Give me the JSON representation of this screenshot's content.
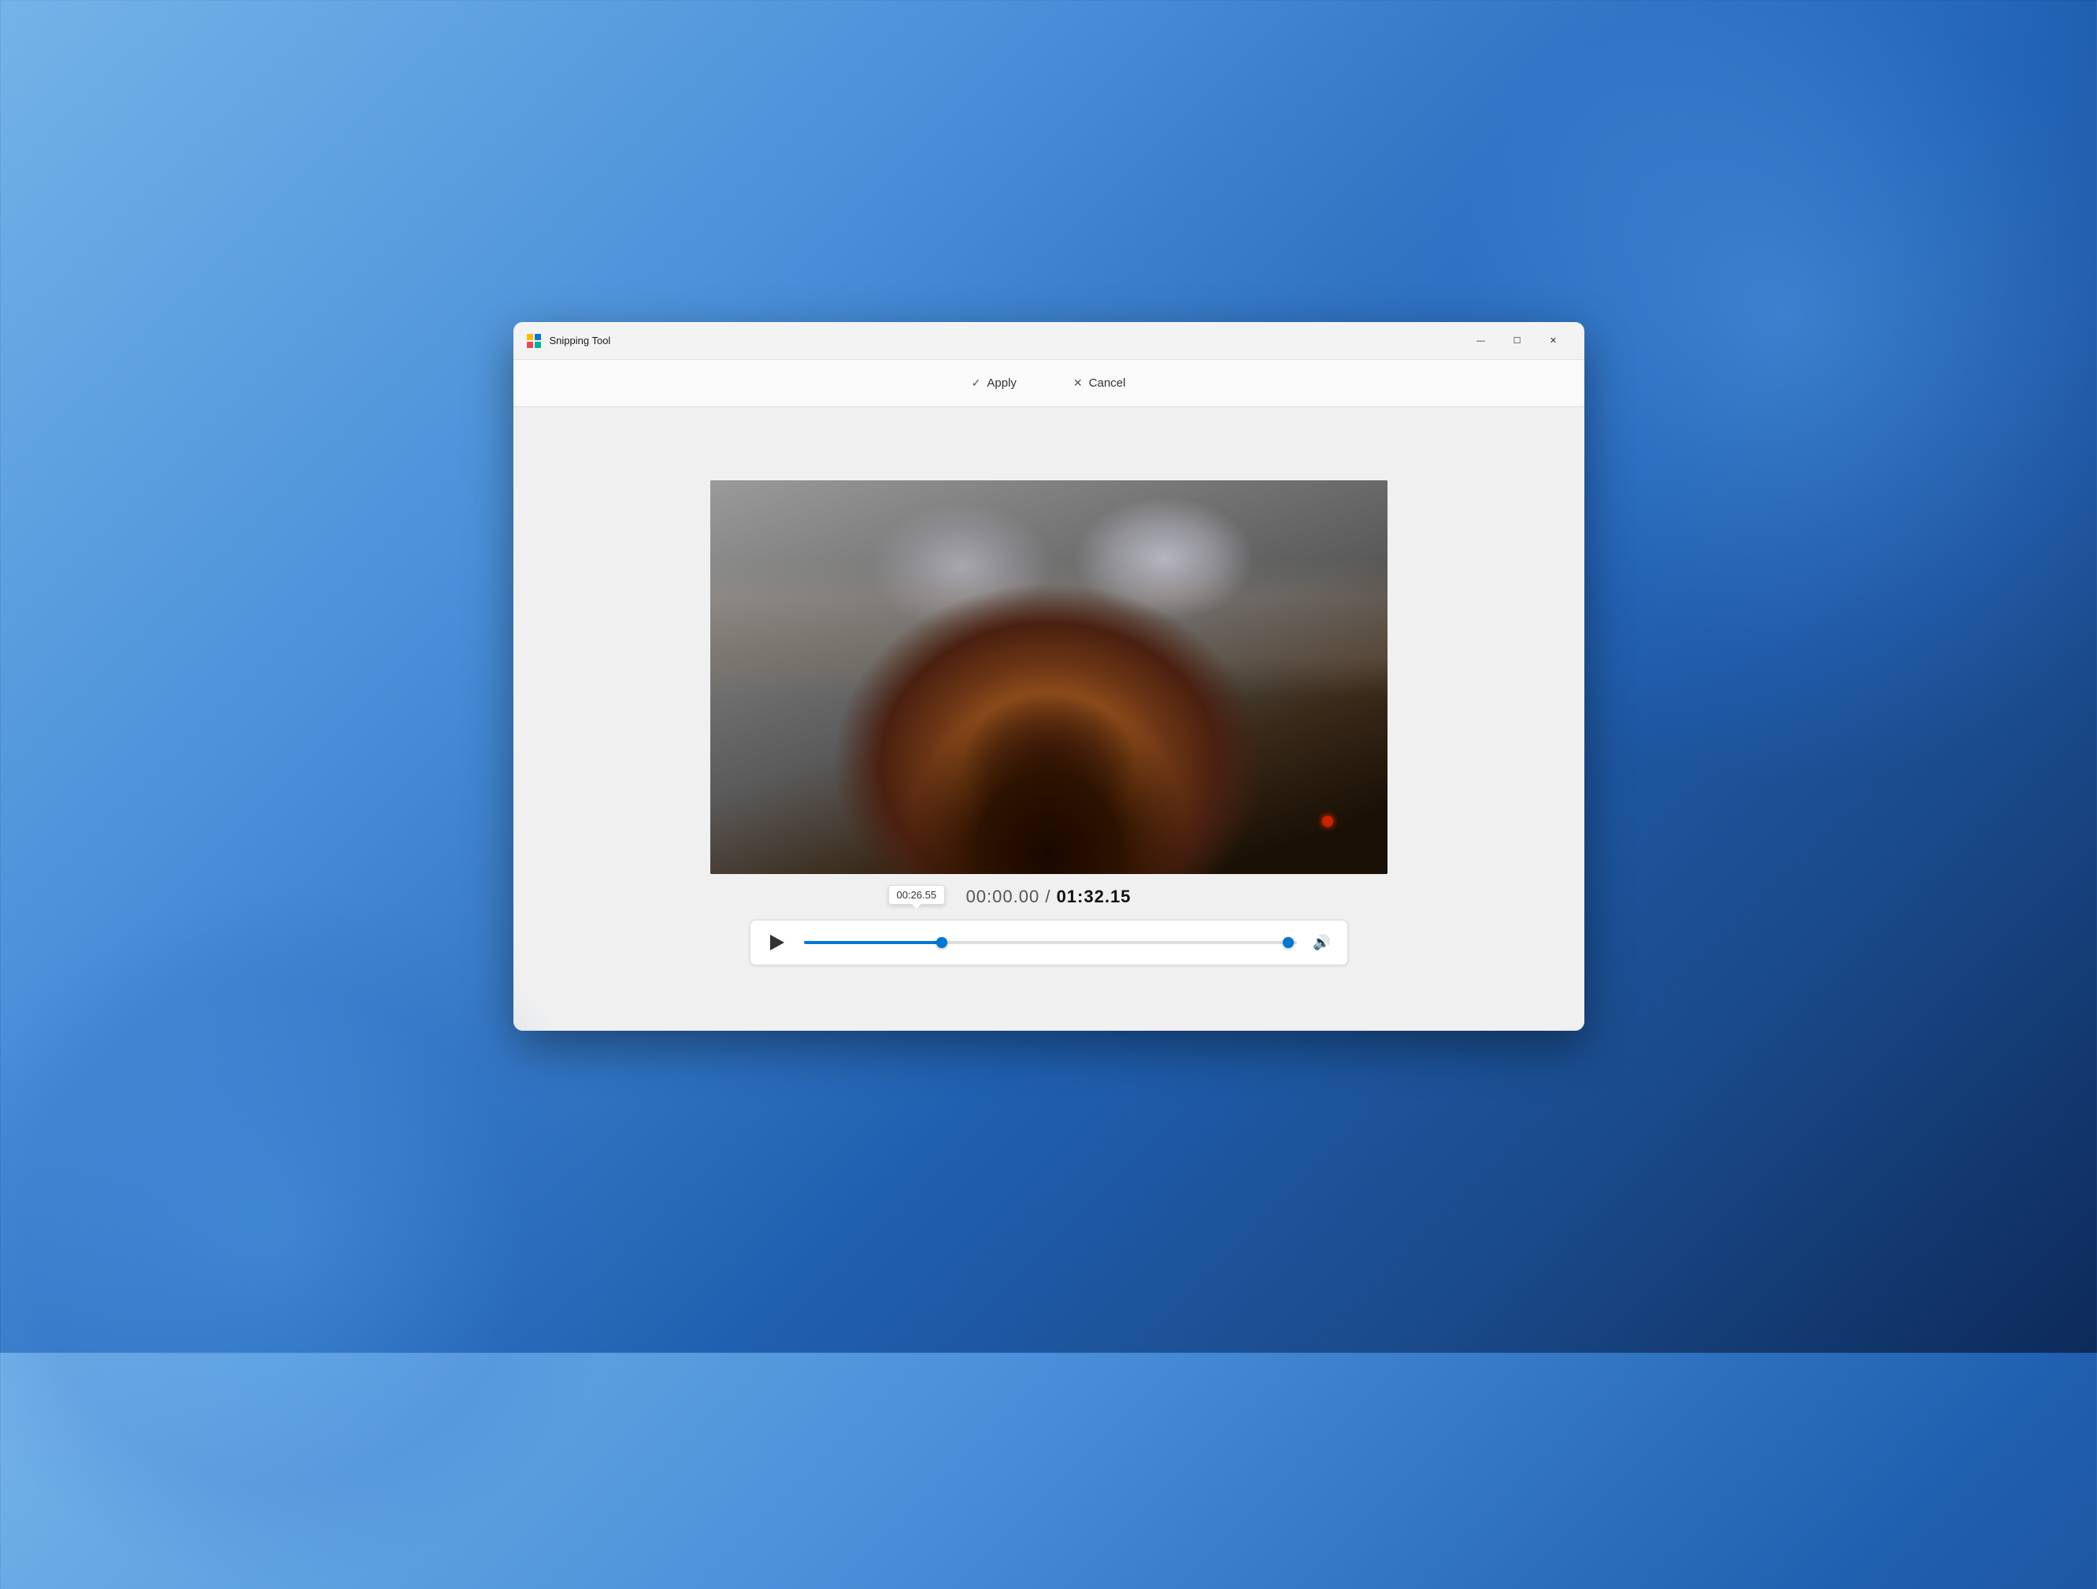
{
  "window": {
    "title": "Snipping Tool",
    "controls": {
      "minimize": "—",
      "maximize": "☐",
      "close": "✕"
    }
  },
  "toolbar": {
    "apply_label": "Apply",
    "cancel_label": "Cancel"
  },
  "video": {
    "current_time": "00:00.00",
    "separator": " / ",
    "total_time": "01:32.15",
    "tooltip_time": "00:26.55",
    "scrubber_position_pct": 28,
    "right_handle_pct": 96
  }
}
